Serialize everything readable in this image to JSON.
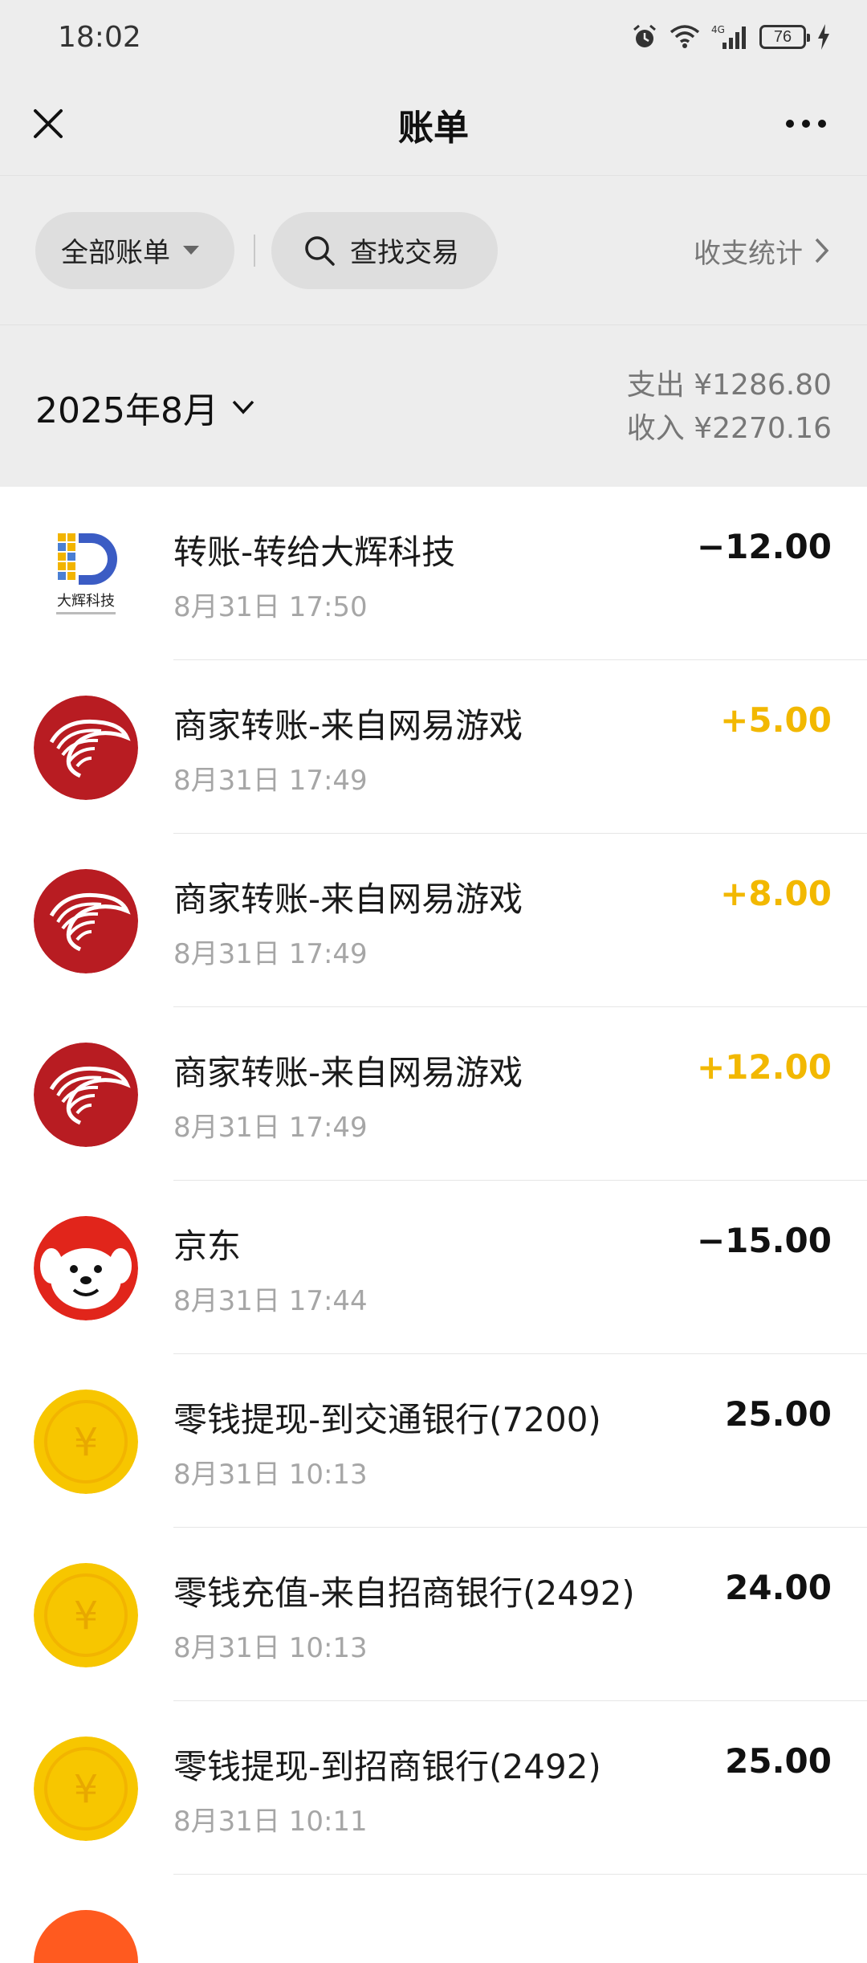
{
  "status_bar": {
    "time": "18:02",
    "network": "4G",
    "battery": "76"
  },
  "nav": {
    "title": "账单"
  },
  "filters": {
    "all_bills": "全部账单",
    "search": "查找交易",
    "stats": "收支统计"
  },
  "month": {
    "label": "2025年8月",
    "expense": "支出 ¥1286.80",
    "income": "收入 ¥2270.16"
  },
  "transactions": [
    {
      "title": "转账-转给大辉科技",
      "time": "8月31日 17:50",
      "amount": "−12.00",
      "type": "expense",
      "icon": "dahui-tech-logo",
      "logo_text": "大辉科技"
    },
    {
      "title": "商家转账-来自网易游戏",
      "time": "8月31日 17:49",
      "amount": "+5.00",
      "type": "income",
      "icon": "netease-games-logo"
    },
    {
      "title": "商家转账-来自网易游戏",
      "time": "8月31日 17:49",
      "amount": "+8.00",
      "type": "income",
      "icon": "netease-games-logo"
    },
    {
      "title": "商家转账-来自网易游戏",
      "time": "8月31日 17:49",
      "amount": "+12.00",
      "type": "income",
      "icon": "netease-games-logo"
    },
    {
      "title": "京东",
      "time": "8月31日 17:44",
      "amount": "−15.00",
      "type": "expense",
      "icon": "jd-joy-dog-logo"
    },
    {
      "title": "零钱提现-到交通银行(7200)",
      "time": "8月31日 10:13",
      "amount": "25.00",
      "type": "neutral",
      "icon": "yuan-coin-icon",
      "coin_text": "¥"
    },
    {
      "title": "零钱充值-来自招商银行(2492)",
      "time": "8月31日 10:13",
      "amount": "24.00",
      "type": "neutral",
      "icon": "yuan-coin-icon",
      "coin_text": "¥"
    },
    {
      "title": "零钱提现-到招商银行(2492)",
      "time": "8月31日 10:11",
      "amount": "25.00",
      "type": "neutral",
      "icon": "yuan-coin-icon",
      "coin_text": "¥"
    }
  ],
  "colors": {
    "income": "#f2b800",
    "header_bg": "#ededed",
    "coin": "#f7c600",
    "netease_red": "#c4161c",
    "jd_red": "#e1251b"
  }
}
